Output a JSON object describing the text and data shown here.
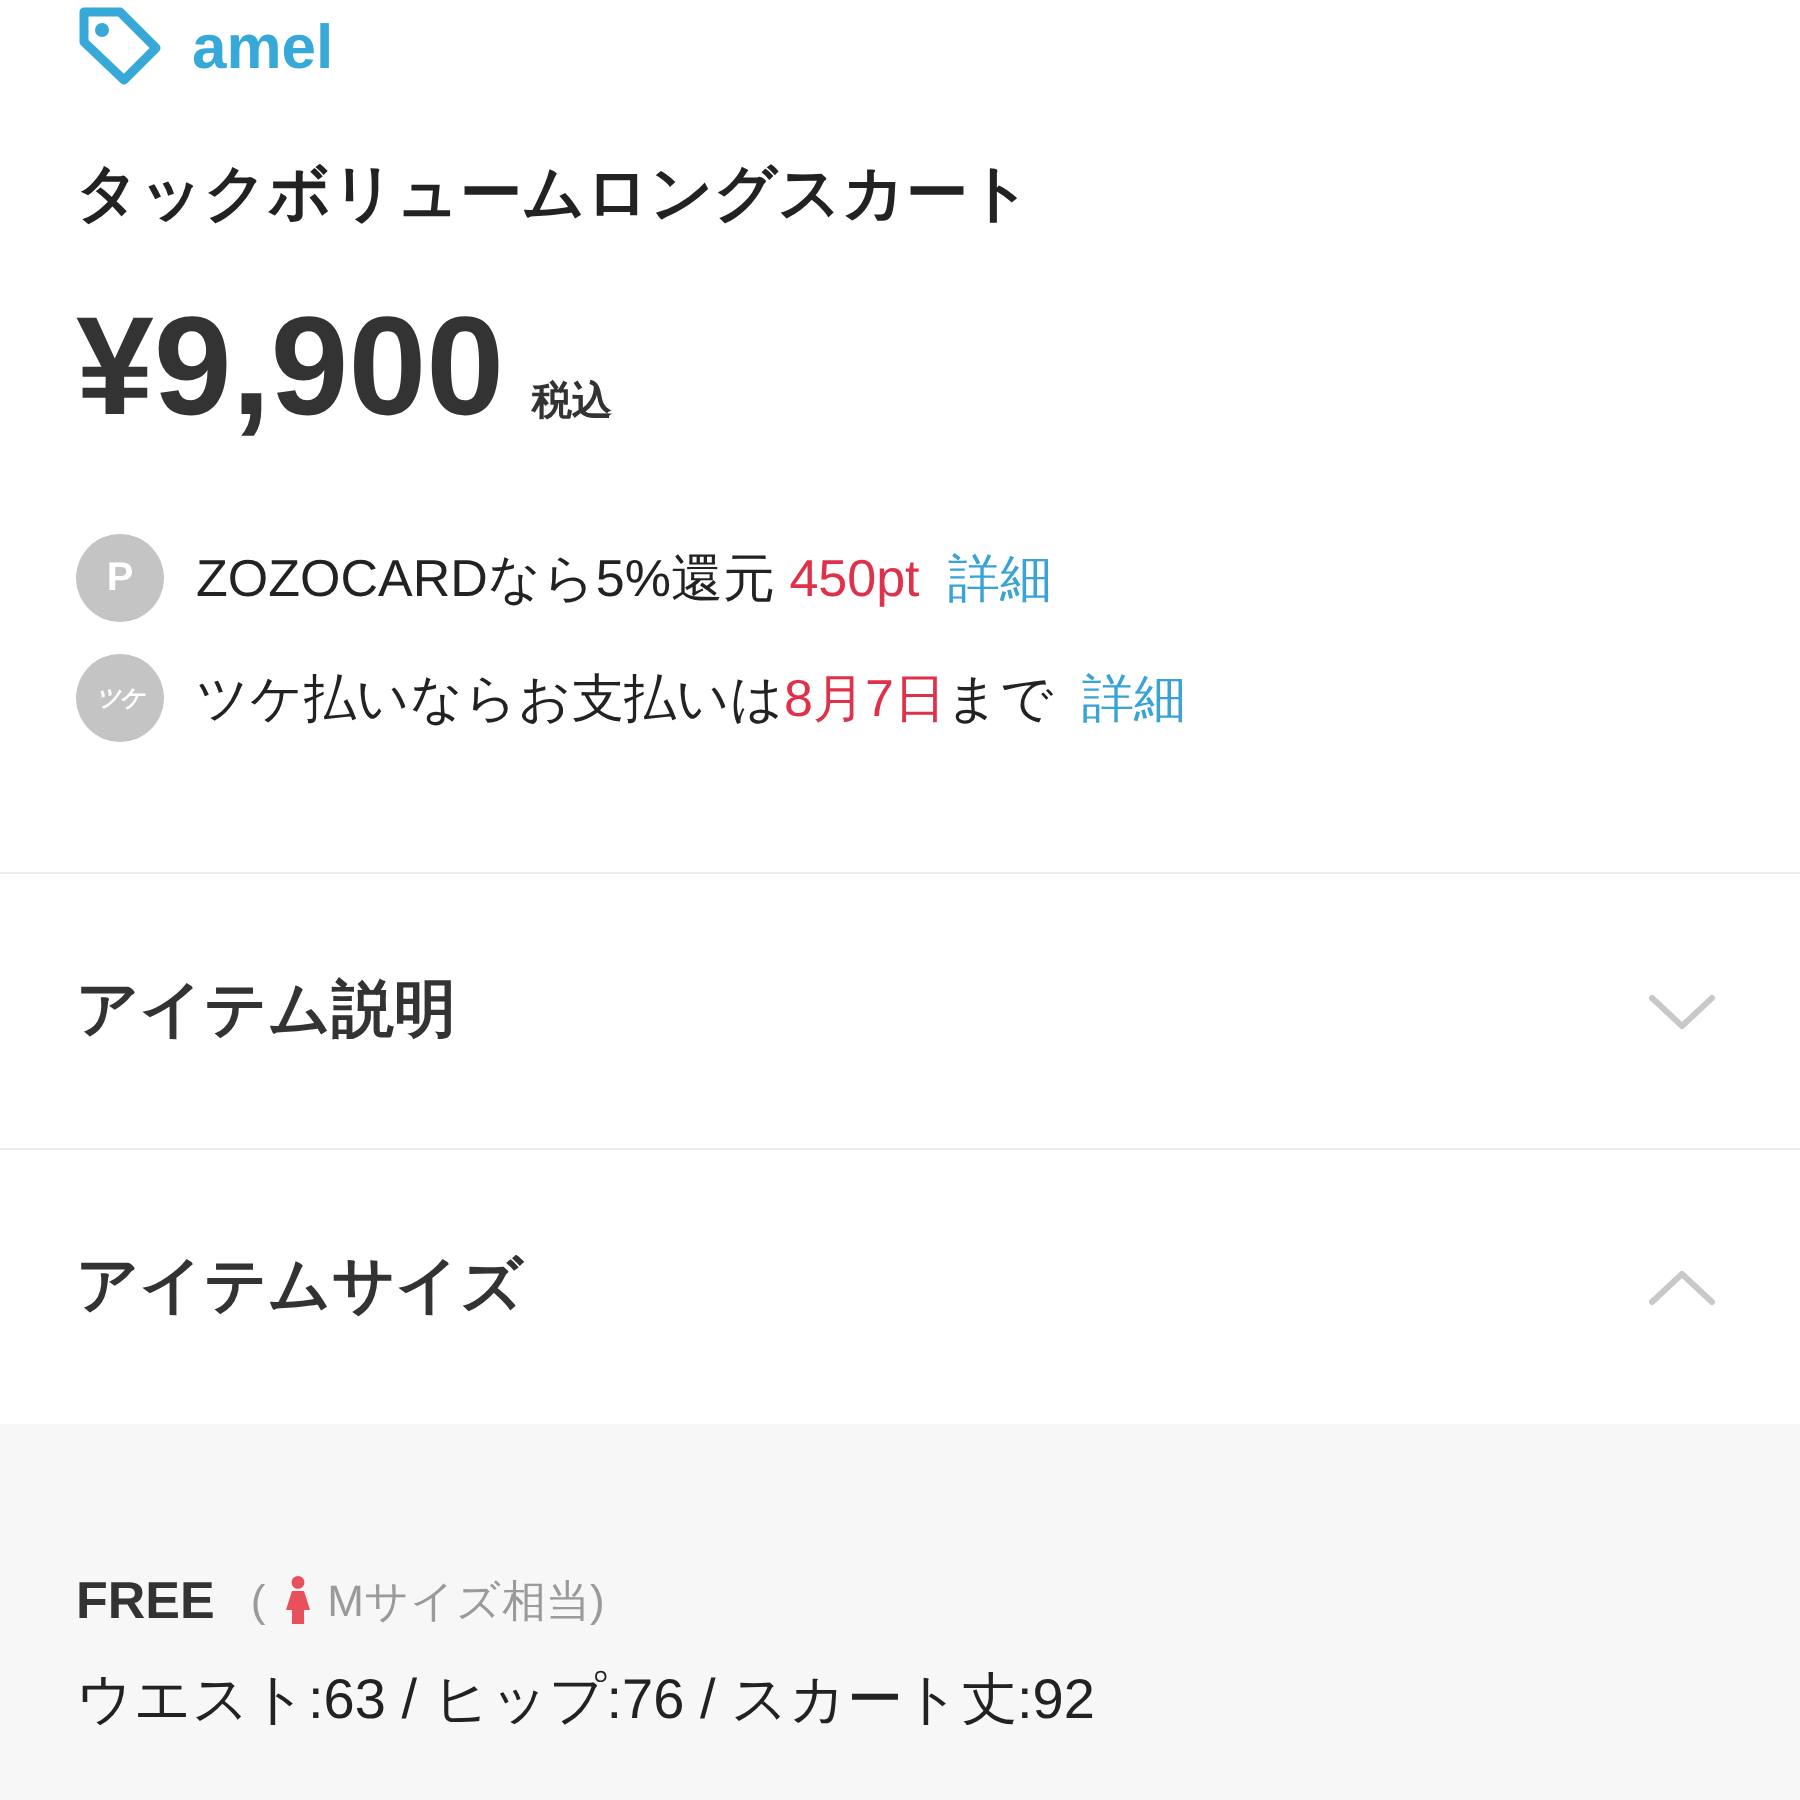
{
  "brand": {
    "name": "amel"
  },
  "product": {
    "title": "タックボリュームロングスカート",
    "price": "¥9,900",
    "tax_note": "税込"
  },
  "benefits": [
    {
      "kind": "points",
      "icon_text": "P",
      "segments": [
        {
          "text": "ZOZOCARDなら5%還元 ",
          "highlight": false
        },
        {
          "text": "450pt",
          "highlight": true
        }
      ],
      "link": "詳細"
    },
    {
      "kind": "deferred_payment",
      "icon_text": "ツケ",
      "segments": [
        {
          "text": "ツケ払いならお支払いは",
          "highlight": false
        },
        {
          "text": "8月7日",
          "highlight": true
        },
        {
          "text": "まで",
          "highlight": false
        }
      ],
      "link": "詳細"
    }
  ],
  "sections": [
    {
      "title": "アイテム説明",
      "expanded": false
    },
    {
      "title": "アイテムサイズ",
      "expanded": true,
      "content": {
        "size": "FREE",
        "note_open": "(",
        "note": "Mサイズ相当)",
        "measurements": "ウエスト:63 / ヒップ:76 / スカート丈:92"
      }
    }
  ]
}
